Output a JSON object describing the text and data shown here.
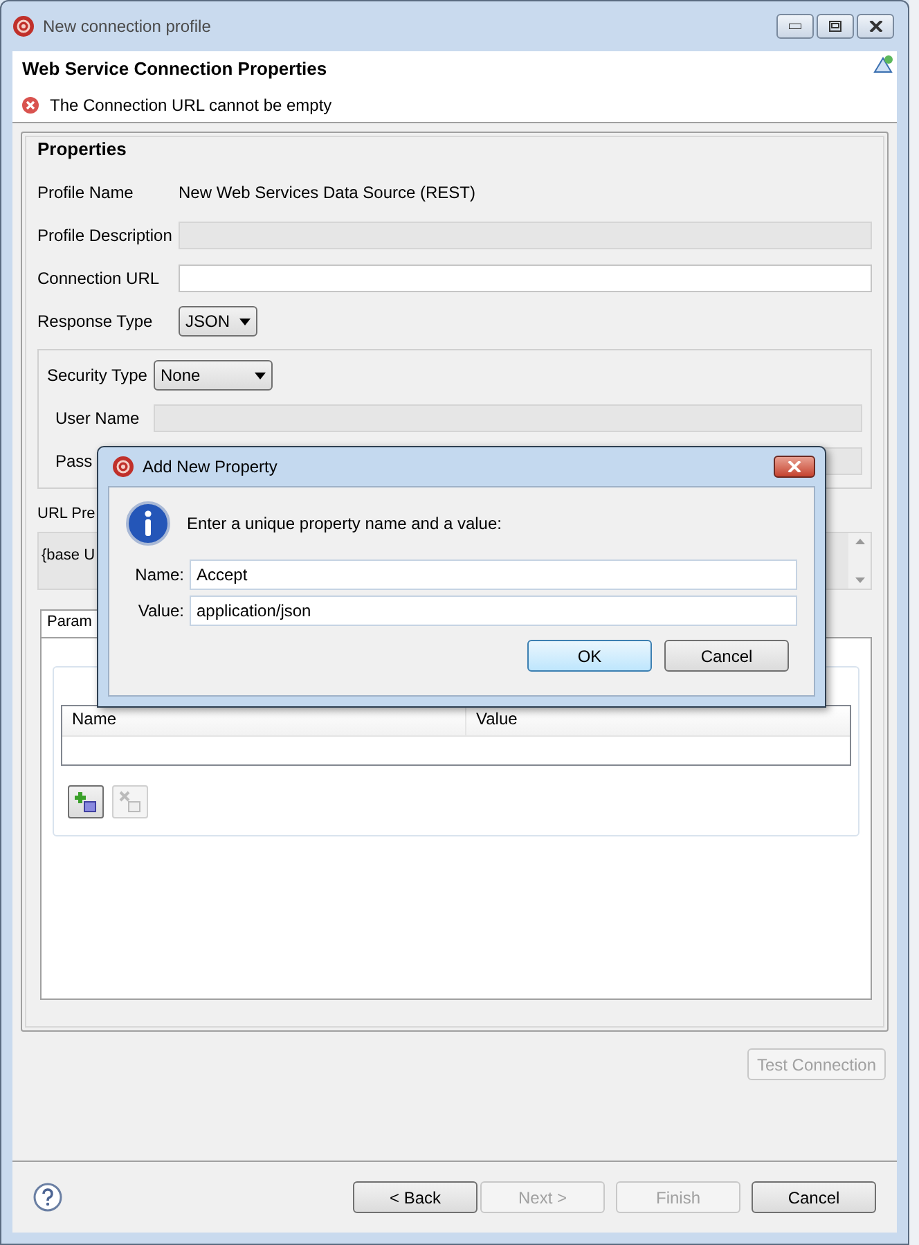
{
  "window": {
    "title": "New connection profile"
  },
  "header": {
    "title": "Web Service Connection Properties",
    "error": "The Connection URL cannot be empty"
  },
  "properties": {
    "title": "Properties",
    "fields": [
      {
        "kind": "text",
        "label": "Profile Name",
        "value": "New Web Services Data Source (REST)"
      },
      {
        "kind": "input",
        "label": "Profile Description",
        "disabled": true
      },
      {
        "kind": "input",
        "label": "Connection URL",
        "disabled": false
      },
      {
        "kind": "combo",
        "label": "Response Type",
        "value": "JSON"
      }
    ],
    "security": [
      {
        "kind": "combo",
        "label": "Security Type",
        "value": "None"
      },
      {
        "kind": "input",
        "label": "User Name",
        "disabled": true
      },
      {
        "kind": "input",
        "label": "Pass",
        "disabled": true
      }
    ],
    "url_preview": {
      "label": "URL Pre",
      "value": "{base U"
    },
    "tabs": [
      {
        "label": "Param",
        "selected": true
      }
    ],
    "table": {
      "columns": [
        "Name",
        "Value"
      ]
    },
    "tool_buttons": [
      {
        "kind": "add",
        "disabled": false
      },
      {
        "kind": "remove",
        "disabled": true
      }
    ]
  },
  "test_button": {
    "label": "Test Connection",
    "disabled": true
  },
  "footer_buttons": [
    {
      "label": "< Back",
      "disabled": false
    },
    {
      "label": "Next >",
      "disabled": true
    },
    {
      "label": "Finish",
      "disabled": true
    },
    {
      "label": "Cancel",
      "disabled": false
    }
  ],
  "dialog": {
    "title": "Add New Property",
    "message": "Enter a unique property name and a value:",
    "fields": [
      {
        "label": "Name:",
        "value": "Accept"
      },
      {
        "label": "Value:",
        "value": "application/json"
      }
    ],
    "buttons": [
      {
        "label": "OK",
        "default": true
      },
      {
        "label": "Cancel",
        "default": false
      }
    ]
  }
}
